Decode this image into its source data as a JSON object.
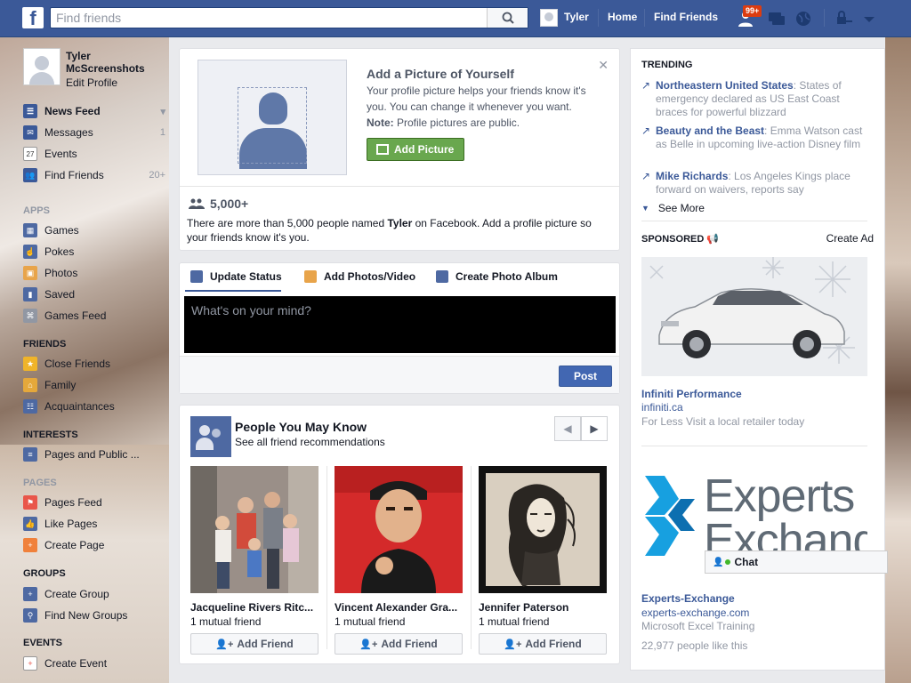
{
  "topbar": {
    "search_placeholder": "Find friends",
    "user_name": "Tyler",
    "home": "Home",
    "find_friends": "Find Friends",
    "notif_badge": "99+"
  },
  "profile": {
    "name": "Tyler McScreenshots",
    "edit": "Edit Profile"
  },
  "sidebar": {
    "nav": [
      {
        "label": "News Feed",
        "count": ""
      },
      {
        "label": "Messages",
        "count": "1"
      },
      {
        "label": "Events",
        "count": ""
      },
      {
        "label": "Find Friends",
        "count": "20+"
      }
    ],
    "apps_head": "APPS",
    "apps": [
      "Games",
      "Pokes",
      "Photos",
      "Saved",
      "Games Feed"
    ],
    "friends_head": "FRIENDS",
    "friends": [
      "Close Friends",
      "Family",
      "Acquaintances"
    ],
    "interests_head": "INTERESTS",
    "interests": [
      "Pages and Public ..."
    ],
    "pages_head": "PAGES",
    "pages": [
      "Pages Feed",
      "Like Pages",
      "Create Page"
    ],
    "groups_head": "GROUPS",
    "groups": [
      "Create Group",
      "Find New Groups"
    ],
    "events_head": "EVENTS",
    "events": [
      "Create Event"
    ],
    "events_icon_num": "27"
  },
  "profile_prompt": {
    "title": "Add a Picture of Yourself",
    "text": "Your profile picture helps your friends know it's you. You can change it whenever you want.",
    "note_label": "Note:",
    "note_text": " Profile pictures are public.",
    "button": "Add Picture",
    "count": "5,000+",
    "desc_pre": "There are more than 5,000 people named ",
    "desc_name": "Tyler",
    "desc_post": " on Facebook. Add a profile picture so your friends know it's you."
  },
  "composer": {
    "tabs": [
      "Update Status",
      "Add Photos/Video",
      "Create Photo Album"
    ],
    "placeholder": "What's on your mind?",
    "post": "Post"
  },
  "pymk": {
    "title": "People You May Know",
    "subtitle": "See all friend recommendations",
    "people": [
      {
        "name": "Jacqueline Rivers Ritc...",
        "mutual": "1 mutual friend",
        "add": "Add Friend"
      },
      {
        "name": "Vincent Alexander Gra...",
        "mutual": "1 mutual friend",
        "add": "Add Friend"
      },
      {
        "name": "Jennifer Paterson",
        "mutual": "1 mutual friend",
        "add": "Add Friend"
      }
    ]
  },
  "trending": {
    "head": "TRENDING",
    "items": [
      {
        "topic": "Northeastern United States",
        "text": ": States of emergency declared as US East Coast braces for powerful blizzard"
      },
      {
        "topic": "Beauty and the Beast",
        "text": ": Emma Watson cast as Belle in upcoming live-action Disney film"
      },
      {
        "topic": "Mike Richards",
        "text": ": Los Angeles Kings place forward on waivers, reports say"
      }
    ],
    "see_more": "See More"
  },
  "sponsored": {
    "head": "SPONSORED",
    "create_ad": "Create Ad",
    "ads": [
      {
        "title": "Infiniti Performance",
        "url": "infiniti.ca",
        "desc": "For Less Visit a local retailer today"
      },
      {
        "title": "Experts-Exchange",
        "url": "experts-exchange.com",
        "desc": "Microsoft Excel Training",
        "likes": "22,977 people like this",
        "logo_text": "Experts Exchange"
      }
    ]
  },
  "chat": {
    "label": "Chat"
  },
  "colors": {
    "brand": "#3b5998",
    "green": "#69a74e",
    "notify": "#dd3c10"
  }
}
